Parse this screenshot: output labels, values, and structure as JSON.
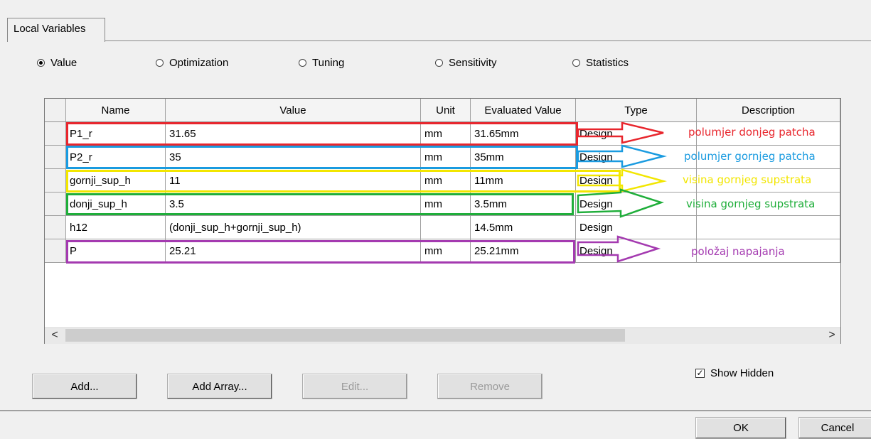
{
  "tab": {
    "label": "Local Variables"
  },
  "radios": [
    {
      "label": "Value",
      "checked": true
    },
    {
      "label": "Optimization",
      "checked": false
    },
    {
      "label": "Tuning",
      "checked": false
    },
    {
      "label": "Sensitivity",
      "checked": false
    },
    {
      "label": "Statistics",
      "checked": false
    }
  ],
  "table": {
    "columns": [
      "Name",
      "Value",
      "Unit",
      "Evaluated Value",
      "Type",
      "Description"
    ],
    "rows": [
      {
        "name": "P1_r",
        "value": "31.65",
        "unit": "mm",
        "evaluated": "31.65mm",
        "type": "Design",
        "description": ""
      },
      {
        "name": "P2_r",
        "value": "35",
        "unit": "mm",
        "evaluated": "35mm",
        "type": "Design",
        "description": ""
      },
      {
        "name": "gornji_sup_h",
        "value": "11",
        "unit": "mm",
        "evaluated": "11mm",
        "type": "Design",
        "description": ""
      },
      {
        "name": "donji_sup_h",
        "value": "3.5",
        "unit": "mm",
        "evaluated": "3.5mm",
        "type": "Design",
        "description": ""
      },
      {
        "name": "h12",
        "value": "(donji_sup_h+gornji_sup_h)",
        "unit": "",
        "evaluated": "14.5mm",
        "type": "Design",
        "description": ""
      },
      {
        "name": "P",
        "value": "25.21",
        "unit": "mm",
        "evaluated": "25.21mm",
        "type": "Design",
        "description": ""
      }
    ]
  },
  "scrollbar": {
    "left_arrow": "<",
    "right_arrow": ">"
  },
  "buttons": {
    "add": "Add...",
    "add_array": "Add Array...",
    "edit": "Edit...",
    "remove": "Remove",
    "ok": "OK",
    "cancel": "Cancel"
  },
  "show_hidden": {
    "label": "Show Hidden",
    "checked": true
  },
  "annotations": [
    {
      "text": "polumjer donjeg patcha",
      "color": "#e8262d"
    },
    {
      "text": "polumjer gornjeg patcha",
      "color": "#1a9be0"
    },
    {
      "text": "visina gornjeg supstrata",
      "color": "#f2e600"
    },
    {
      "text": "visina gornjeg supstrata",
      "color": "#1fae3a"
    },
    {
      "text": "položaj napajanja",
      "color": "#a43ab0"
    }
  ]
}
